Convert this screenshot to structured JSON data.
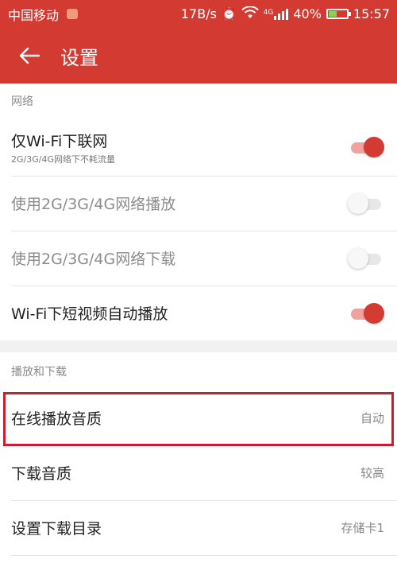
{
  "status_bar": {
    "carrier": "中国移动",
    "speed": "17B/s",
    "network_type": "4G",
    "battery": "40%",
    "battery_level": 0.4,
    "time": "15:57",
    "icons": [
      "alarm-icon",
      "wifi-icon",
      "signal-icon",
      "battery-icon"
    ]
  },
  "app_bar": {
    "title": "设置",
    "back_icon": "back-arrow-icon"
  },
  "sections": {
    "network": {
      "header": "网络",
      "rows": [
        {
          "title": "仅Wi-Fi下联网",
          "subtitle": "2G/3G/4G网络下不耗流量",
          "toggle": true
        },
        {
          "title": "使用2G/3G/4G网络播放",
          "toggle": false,
          "disabled": true
        },
        {
          "title": "使用2G/3G/4G网络下载",
          "toggle": false,
          "disabled": true
        },
        {
          "title": "Wi-Fi下短视频自动播放",
          "toggle": true
        }
      ]
    },
    "playback": {
      "header": "播放和下载",
      "rows": [
        {
          "title": "在线播放音质",
          "value": "自动"
        },
        {
          "title": "下载音质",
          "value": "较高"
        },
        {
          "title": "设置下载目录",
          "value": "存储卡1"
        }
      ]
    }
  },
  "colors": {
    "accent": "#d33a32",
    "highlight_border": "#d41a2a"
  }
}
